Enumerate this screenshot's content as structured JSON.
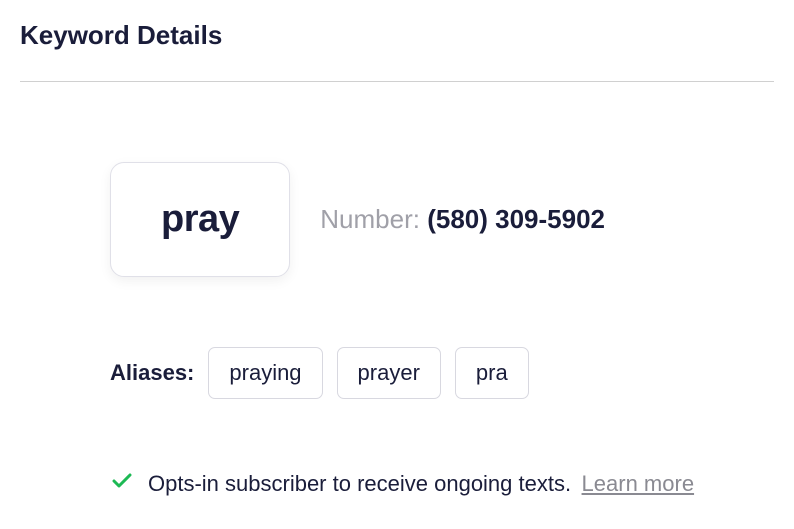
{
  "header": {
    "title": "Keyword Details"
  },
  "keyword": {
    "value": "pray",
    "number_label": "Number: ",
    "number_value": "(580) 309-5902"
  },
  "aliases": {
    "label": "Aliases:",
    "items": [
      "praying",
      "prayer",
      "pra"
    ]
  },
  "optin": {
    "message": "Opts-in subscriber to receive ongoing texts.",
    "learn_more": "Learn more"
  }
}
